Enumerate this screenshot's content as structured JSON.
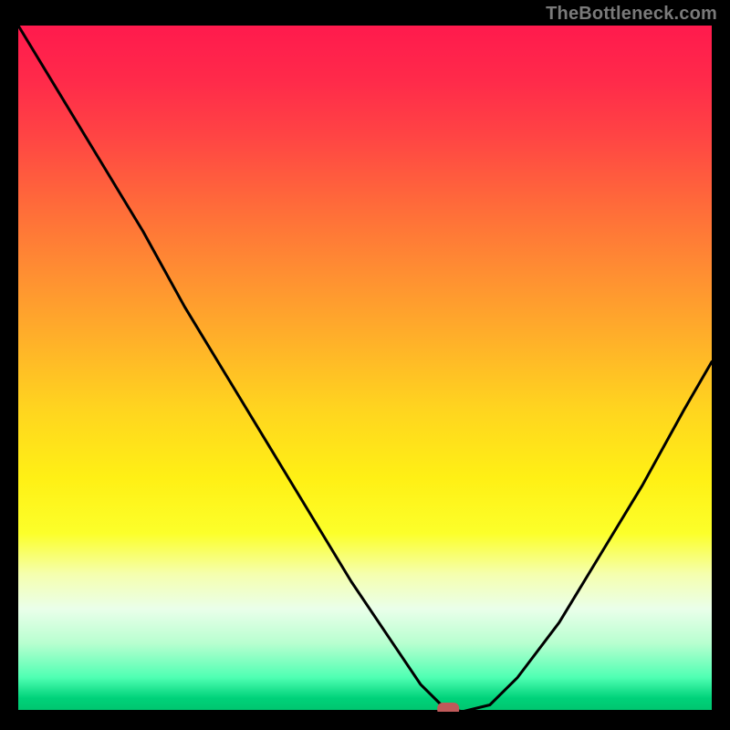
{
  "attribution": "TheBottleneck.com",
  "chart_data": {
    "type": "line",
    "title": "",
    "xlabel": "",
    "ylabel": "",
    "xlim": [
      0,
      100
    ],
    "ylim": [
      0,
      100
    ],
    "grid": false,
    "legend": false,
    "series": [
      {
        "name": "bottleneck-curve",
        "x": [
          0,
          6,
          12,
          18,
          24,
          30,
          36,
          42,
          48,
          54,
          58,
          61,
          64,
          68,
          72,
          78,
          84,
          90,
          96,
          100
        ],
        "values": [
          100,
          90,
          80,
          70,
          59,
          49,
          39,
          29,
          19,
          10,
          4,
          1,
          0,
          1,
          5,
          13,
          23,
          33,
          44,
          51
        ]
      }
    ],
    "flat_segment": {
      "x_start": 58,
      "x_end": 64,
      "value": 0
    },
    "marker": {
      "x": 62,
      "y": 0,
      "color": "#c05a5a",
      "shape": "rounded-rect"
    },
    "background_gradient": {
      "stops": [
        {
          "pos": 0.0,
          "color": "#ff1a4d"
        },
        {
          "pos": 0.16,
          "color": "#ff4444"
        },
        {
          "pos": 0.36,
          "color": "#ff8e32"
        },
        {
          "pos": 0.56,
          "color": "#ffd51f"
        },
        {
          "pos": 0.74,
          "color": "#fcff2a"
        },
        {
          "pos": 0.85,
          "color": "#eaffea"
        },
        {
          "pos": 0.95,
          "color": "#4fffb3"
        },
        {
          "pos": 1.0,
          "color": "#00c46e"
        }
      ]
    }
  }
}
